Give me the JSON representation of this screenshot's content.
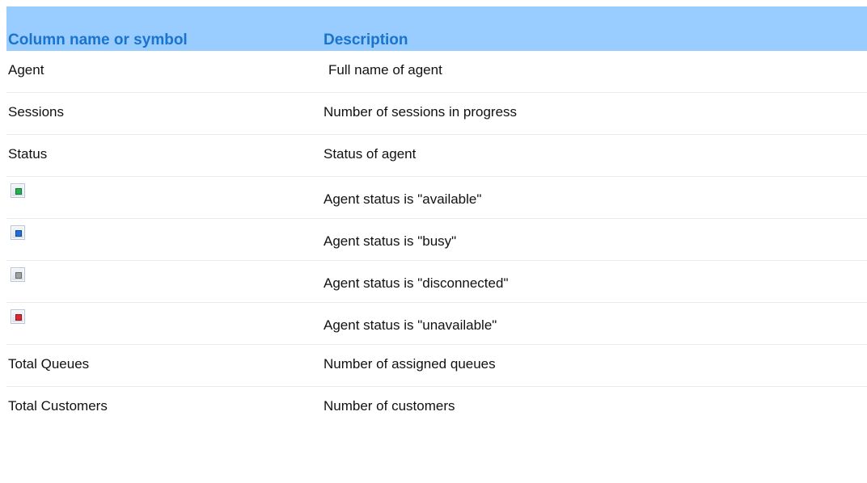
{
  "header": {
    "col1": "Column name or symbol",
    "col2": "Description"
  },
  "rows": [
    {
      "name": "Agent",
      "description": "Full name of agent"
    },
    {
      "name": "Sessions",
      "description": "Number of sessions in progress"
    },
    {
      "name": "Status",
      "description": "Status of agent"
    },
    {
      "icon": "status-available-icon",
      "icon_color": "#22b14c",
      "description": "Agent status is \"available\""
    },
    {
      "icon": "status-busy-icon",
      "icon_color": "#1e6fd9",
      "description": "Agent status is \"busy\""
    },
    {
      "icon": "status-disconnected-icon",
      "icon_color": "#a0a0a0",
      "description": "Agent status is \"disconnected\""
    },
    {
      "icon": "status-unavailable-icon",
      "icon_color": "#e0252b",
      "description": "Agent status is \"unavailable\""
    },
    {
      "name": "Total Queues",
      "description": "Number of assigned queues"
    },
    {
      "name": "Total Customers",
      "description": "Number of customers"
    }
  ],
  "colors": {
    "header_bg": "#99ccff",
    "header_text": "#1a73cc"
  }
}
